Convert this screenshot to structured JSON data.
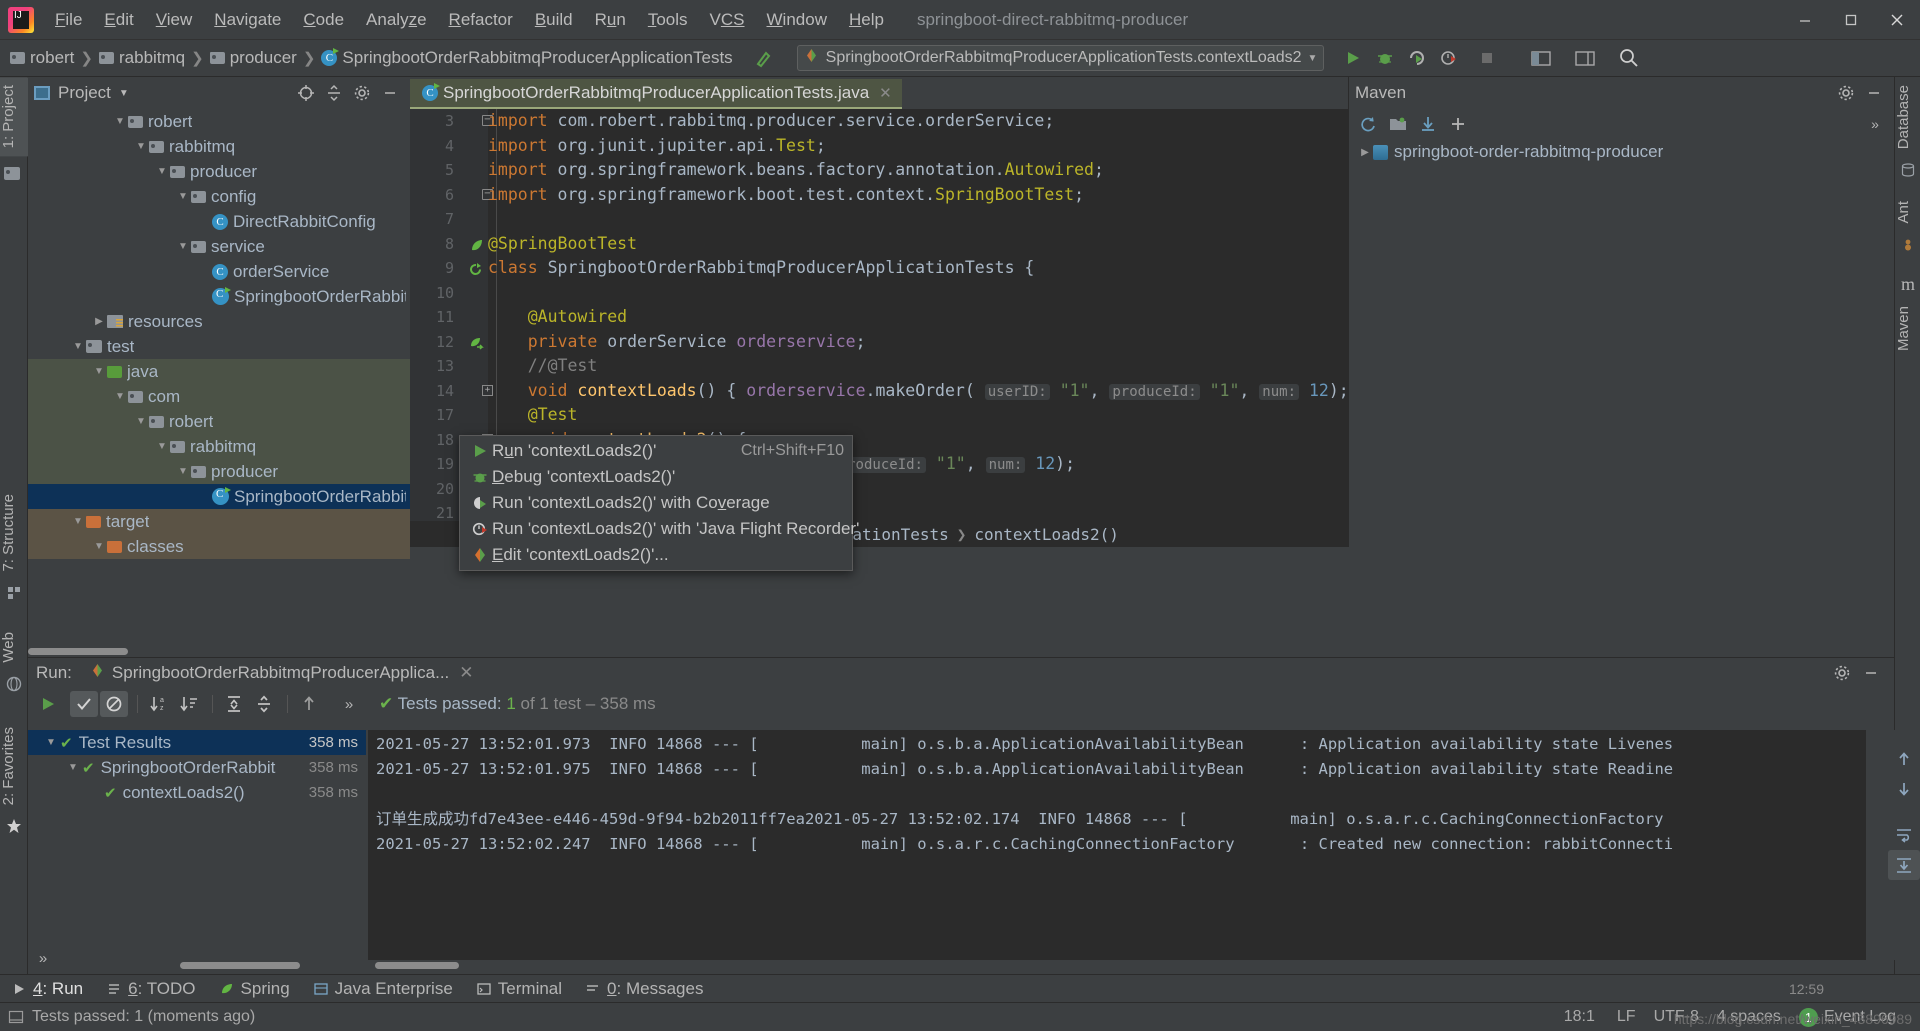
{
  "window": {
    "project_title": "springboot-direct-rabbitmq-producer",
    "minimize": "minimize-icon",
    "maximize": "maximize-icon",
    "close": "close-icon"
  },
  "menubar": {
    "items": [
      {
        "label": "File",
        "mnemonic": "F"
      },
      {
        "label": "Edit",
        "mnemonic": "E"
      },
      {
        "label": "View",
        "mnemonic": "V"
      },
      {
        "label": "Navigate",
        "mnemonic": "N"
      },
      {
        "label": "Code",
        "mnemonic": "C"
      },
      {
        "label": "Analyze",
        "mnemonic": "z"
      },
      {
        "label": "Refactor",
        "mnemonic": "R"
      },
      {
        "label": "Build",
        "mnemonic": "B"
      },
      {
        "label": "Run",
        "mnemonic": "u"
      },
      {
        "label": "Tools",
        "mnemonic": "T"
      },
      {
        "label": "VCS",
        "mnemonic": "CS"
      },
      {
        "label": "Window",
        "mnemonic": "W"
      },
      {
        "label": "Help",
        "mnemonic": "H"
      }
    ]
  },
  "breadcrumb": {
    "items": [
      "robert",
      "rabbitmq",
      "producer",
      "SpringbootOrderRabbitmqProducerApplicationTests"
    ]
  },
  "run_config": {
    "label": "SpringbootOrderRabbitmqProducerApplicationTests.contextLoads2",
    "icons": [
      "run-icon",
      "debug-icon",
      "run-with-coverage-icon",
      "profile-icon",
      "stop-icon",
      "project-structure-icon",
      "layout-icon",
      "search-everywhere-icon"
    ]
  },
  "left_strip": {
    "project_tab": "1: Project",
    "structure_tab": "7: Structure",
    "web_tab": "Web",
    "favorites_tab": "2: Favorites"
  },
  "right_strip": {
    "database_tab": "Database",
    "ant_tab": "Ant",
    "maven_tab": "Maven"
  },
  "project_panel": {
    "title": "Project",
    "tree": [
      {
        "label": "robert",
        "indent": 4,
        "arrow": "down",
        "icon": "folder-package",
        "state": "normal"
      },
      {
        "label": "rabbitmq",
        "indent": 5,
        "arrow": "down",
        "icon": "folder-package",
        "state": "normal"
      },
      {
        "label": "producer",
        "indent": 6,
        "arrow": "down",
        "icon": "folder-package",
        "state": "normal"
      },
      {
        "label": "config",
        "indent": 7,
        "arrow": "down",
        "icon": "folder-package",
        "state": "normal"
      },
      {
        "label": "DirectRabbitConfig",
        "indent": 8,
        "arrow": "none",
        "icon": "class",
        "state": "normal"
      },
      {
        "label": "service",
        "indent": 7,
        "arrow": "down",
        "icon": "folder-package",
        "state": "normal"
      },
      {
        "label": "orderService",
        "indent": 8,
        "arrow": "none",
        "icon": "class",
        "state": "normal"
      },
      {
        "label": "SpringbootOrderRabbitmqProducerApplication",
        "indent": 8,
        "arrow": "none",
        "icon": "spring-class",
        "state": "normal"
      },
      {
        "label": "resources",
        "indent": 3,
        "arrow": "right",
        "icon": "folder-resources",
        "state": "normal"
      },
      {
        "label": "test",
        "indent": 2,
        "arrow": "down",
        "icon": "folder-plain",
        "state": "normal"
      },
      {
        "label": "java",
        "indent": 3,
        "arrow": "down",
        "icon": "folder-green",
        "state": "src"
      },
      {
        "label": "com",
        "indent": 4,
        "arrow": "down",
        "icon": "folder-package",
        "state": "src"
      },
      {
        "label": "robert",
        "indent": 5,
        "arrow": "down",
        "icon": "folder-package",
        "state": "src"
      },
      {
        "label": "rabbitmq",
        "indent": 6,
        "arrow": "down",
        "icon": "folder-package",
        "state": "src"
      },
      {
        "label": "producer",
        "indent": 7,
        "arrow": "down",
        "icon": "folder-package",
        "state": "src"
      },
      {
        "label": "SpringbootOrderRabbitmqProducerApplicationTests",
        "indent": 8,
        "arrow": "none",
        "icon": "spring-class",
        "state": "selected"
      },
      {
        "label": "target",
        "indent": 2,
        "arrow": "down",
        "icon": "folder-orange",
        "state": "target"
      },
      {
        "label": "classes",
        "indent": 3,
        "arrow": "down",
        "icon": "folder-orange",
        "state": "target"
      }
    ]
  },
  "editor": {
    "tab_label": "SpringbootOrderRabbitmqProducerApplicationTests.java",
    "tab_icon": "spring-test-class-icon",
    "tab_close": "close-icon",
    "breadcrumb": [
      "SpringbootOrderRabbitmqProducerApplicationTests",
      "contextLoads2()"
    ],
    "lines": [
      {
        "num": "3",
        "gutter": "",
        "fold": "collapse",
        "tokens": [
          {
            "t": "import ",
            "c": "k"
          },
          {
            "t": "com.robert.rabbitmq.producer.service.orderService",
            "c": "p"
          },
          {
            "t": ";",
            "c": "p"
          }
        ]
      },
      {
        "num": "4",
        "gutter": "",
        "fold": "",
        "tokens": [
          {
            "t": "import ",
            "c": "k"
          },
          {
            "t": "org.junit.jupiter.api.",
            "c": "p"
          },
          {
            "t": "Test",
            "c": "a"
          },
          {
            "t": ";",
            "c": "p"
          }
        ]
      },
      {
        "num": "5",
        "gutter": "",
        "fold": "",
        "tokens": [
          {
            "t": "import ",
            "c": "k"
          },
          {
            "t": "org.springframework.beans.factory.annotation.",
            "c": "p"
          },
          {
            "t": "Autowired",
            "c": "a"
          },
          {
            "t": ";",
            "c": "p"
          }
        ]
      },
      {
        "num": "6",
        "gutter": "",
        "fold": "collapse2",
        "tokens": [
          {
            "t": "import ",
            "c": "k"
          },
          {
            "t": "org.springframework.boot.test.context.",
            "c": "p"
          },
          {
            "t": "SpringBootTest",
            "c": "a"
          },
          {
            "t": ";",
            "c": "p"
          }
        ]
      },
      {
        "num": "7",
        "gutter": "",
        "fold": "",
        "tokens": []
      },
      {
        "num": "8",
        "gutter": "spring-leaf-icon",
        "fold": "",
        "tokens": [
          {
            "t": "@SpringBootTest",
            "c": "a"
          }
        ]
      },
      {
        "num": "9",
        "gutter": "run-test-icon",
        "fold": "",
        "tokens": [
          {
            "t": "class ",
            "c": "k"
          },
          {
            "t": "SpringbootOrderRabbitmqProducerApplicationTests {",
            "c": "p"
          }
        ]
      },
      {
        "num": "10",
        "gutter": "",
        "fold": "",
        "tokens": []
      },
      {
        "num": "11",
        "gutter": "",
        "fold": "",
        "tokens": [
          {
            "t": "    @Autowired",
            "c": "a"
          }
        ]
      },
      {
        "num": "12",
        "gutter": "bean-icon",
        "fold": "",
        "tokens": [
          {
            "t": "    private ",
            "c": "k"
          },
          {
            "t": "orderService ",
            "c": "p"
          },
          {
            "t": "orderservice",
            "c": "f"
          },
          {
            "t": ";",
            "c": "p"
          }
        ]
      },
      {
        "num": "13",
        "gutter": "",
        "fold": "",
        "tokens": [
          {
            "t": "    //@Test",
            "c": "c"
          }
        ]
      },
      {
        "num": "14",
        "gutter": "",
        "fold": "expand",
        "tokens": [
          {
            "t": "    void ",
            "c": "k"
          },
          {
            "t": "contextLoads",
            "c": "t"
          },
          {
            "t": "() { ",
            "c": "p"
          },
          {
            "t": "orderservice",
            "c": "f"
          },
          {
            "t": ".",
            "c": "p"
          },
          {
            "t": "makeOrder",
            "c": "p"
          },
          {
            "t": "( ",
            "c": "p"
          },
          {
            "t": "userID:",
            "c": "hint"
          },
          {
            "t": " ",
            "c": "p"
          },
          {
            "t": "\"1\"",
            "c": "s"
          },
          {
            "t": ", ",
            "c": "p"
          },
          {
            "t": "produceId:",
            "c": "hint"
          },
          {
            "t": " ",
            "c": "p"
          },
          {
            "t": "\"1\"",
            "c": "s"
          },
          {
            "t": ", ",
            "c": "p"
          },
          {
            "t": "num:",
            "c": "hint"
          },
          {
            "t": " ",
            "c": "p"
          },
          {
            "t": "12",
            "c": "n"
          },
          {
            "t": "); }",
            "c": "p"
          }
        ]
      },
      {
        "num": "17",
        "gutter": "",
        "fold": "",
        "tokens": [
          {
            "t": "    @Test",
            "c": "a"
          }
        ]
      },
      {
        "num": "18",
        "gutter": "run-test-icon",
        "fold": "expand2",
        "tokens": [
          {
            "t": "    void ",
            "c": "k"
          },
          {
            "t": "contextLoads2",
            "c": "t"
          },
          {
            "t": "() {",
            "c": "p"
          }
        ]
      },
      {
        "num": "19",
        "gutter": "",
        "fold": "",
        "tokens": [
          {
            "t": "                                   ",
            "c": "p"
          },
          {
            "t": "produceId:",
            "c": "hint"
          },
          {
            "t": " ",
            "c": "p"
          },
          {
            "t": "\"1\"",
            "c": "s"
          },
          {
            "t": ", ",
            "c": "p"
          },
          {
            "t": "num:",
            "c": "hint"
          },
          {
            "t": " ",
            "c": "p"
          },
          {
            "t": "12",
            "c": "n"
          },
          {
            "t": ");",
            "c": "p"
          }
        ]
      },
      {
        "num": "20",
        "gutter": "",
        "fold": "",
        "tokens": []
      },
      {
        "num": "21",
        "gutter": "",
        "fold": "",
        "tokens": []
      }
    ]
  },
  "context_menu": {
    "items": [
      {
        "icon": "run-icon",
        "label": "Run 'contextLoads2()'",
        "mnemonic": "u",
        "shortcut": "Ctrl+Shift+F10"
      },
      {
        "icon": "debug-icon",
        "label": "Debug 'contextLoads2()'",
        "mnemonic": "D",
        "shortcut": ""
      },
      {
        "icon": "coverage-icon",
        "label": "Run 'contextLoads2()' with Coverage",
        "mnemonic": "v",
        "shortcut": ""
      },
      {
        "icon": "flight-recorder-icon",
        "label": "Run 'contextLoads2()' with 'Java Flight Recorder'",
        "mnemonic": "",
        "shortcut": ""
      },
      {
        "icon": "edit-config-icon",
        "label": "Edit 'contextLoads2()'...",
        "mnemonic": "E",
        "shortcut": ""
      }
    ]
  },
  "maven_panel": {
    "title": "Maven",
    "gear": "gear-icon",
    "minimize": "minimize-icon",
    "expand": "expand-icon",
    "toolbar": [
      "reload-icon",
      "new-project-icon",
      "download-sources-icon",
      "add-icon",
      "chevrons-icon"
    ],
    "tree": [
      {
        "label": "springboot-order-rabbitmq-producer",
        "arrow": "right",
        "icon": "maven-module-icon"
      }
    ]
  },
  "run_panel": {
    "label": "Run:",
    "config_name": "SpringbootOrderRabbitmqProducerApplica...",
    "close": "close-icon",
    "gear": "gear-icon",
    "minimize": "minimize-icon",
    "toolbar_icons": [
      "rerun-icon",
      "show-passed-icon",
      "hide-ignored-icon",
      "sort-alphabetically-icon",
      "sort-by-duration-icon",
      "expand-all-icon",
      "collapse-all-icon",
      "prev-test-icon",
      "more-icon"
    ],
    "status_prefix": "Tests passed: ",
    "status_count": "1",
    "status_suffix": " of 1 test – 358 ms",
    "test_tree": [
      {
        "label": "Test Results",
        "time": "358 ms",
        "indent": 0,
        "arrow": "down",
        "selected": true
      },
      {
        "label": "SpringbootOrderRabbit",
        "time": "358 ms",
        "indent": 1,
        "arrow": "down",
        "selected": false
      },
      {
        "label": "contextLoads2()",
        "time": "358 ms",
        "indent": 2,
        "arrow": "none",
        "selected": false
      }
    ],
    "console": [
      "2021-05-27 13:52:01.973  INFO 14868 --- [           main] o.s.b.a.ApplicationAvailabilityBean      : Application availability state Livenes",
      "2021-05-27 13:52:01.975  INFO 14868 --- [           main] o.s.b.a.ApplicationAvailabilityBean      : Application availability state Readine",
      "",
      "订单生成成功fd7e43ee-e446-459d-9f94-b2b2011ff7ea2021-05-27 13:52:02.174  INFO 14868 --- [           main] o.s.a.r.c.CachingConnectionFactory",
      "2021-05-27 13:52:02.247  INFO 14868 --- [           main] o.s.a.r.c.CachingConnectionFactory       : Created new connection: rabbitConnecti"
    ],
    "console_side_icons": [
      "scroll-up-icon",
      "scroll-down-icon",
      "soft-wrap-icon",
      "scroll-to-end-icon"
    ]
  },
  "bottom_bar": {
    "tabs": [
      {
        "icon": "run-icon",
        "label": "4: Run",
        "mnemonic": "4",
        "selected": true
      },
      {
        "icon": "todo-icon",
        "label": "6: TODO",
        "mnemonic": "6",
        "selected": false
      },
      {
        "icon": "spring-icon",
        "label": "Spring",
        "mnemonic": "",
        "selected": false
      },
      {
        "icon": "java-ee-icon",
        "label": "Java Enterprise",
        "mnemonic": "",
        "selected": false
      },
      {
        "icon": "terminal-icon",
        "label": "Terminal",
        "mnemonic": "",
        "selected": false
      },
      {
        "icon": "messages-icon",
        "label": "0: Messages",
        "mnemonic": "0",
        "selected": false
      }
    ]
  },
  "status_bar": {
    "message": "Tests passed: 1 (moments ago)",
    "caret": "18:1",
    "encoding": "UTF-8",
    "indent": "4 spaces",
    "event_log": "Event Log",
    "event_count": "1",
    "watermark": "https://blog.csdn.net/weixin_43896989",
    "watermark2": "12:59"
  },
  "colors": {
    "accent_blue": "#3592c4",
    "green": "#62b543",
    "orange": "#cc7832",
    "selection": "#0d3157",
    "src_root": "#4b5246",
    "target_root": "#5b5345"
  }
}
